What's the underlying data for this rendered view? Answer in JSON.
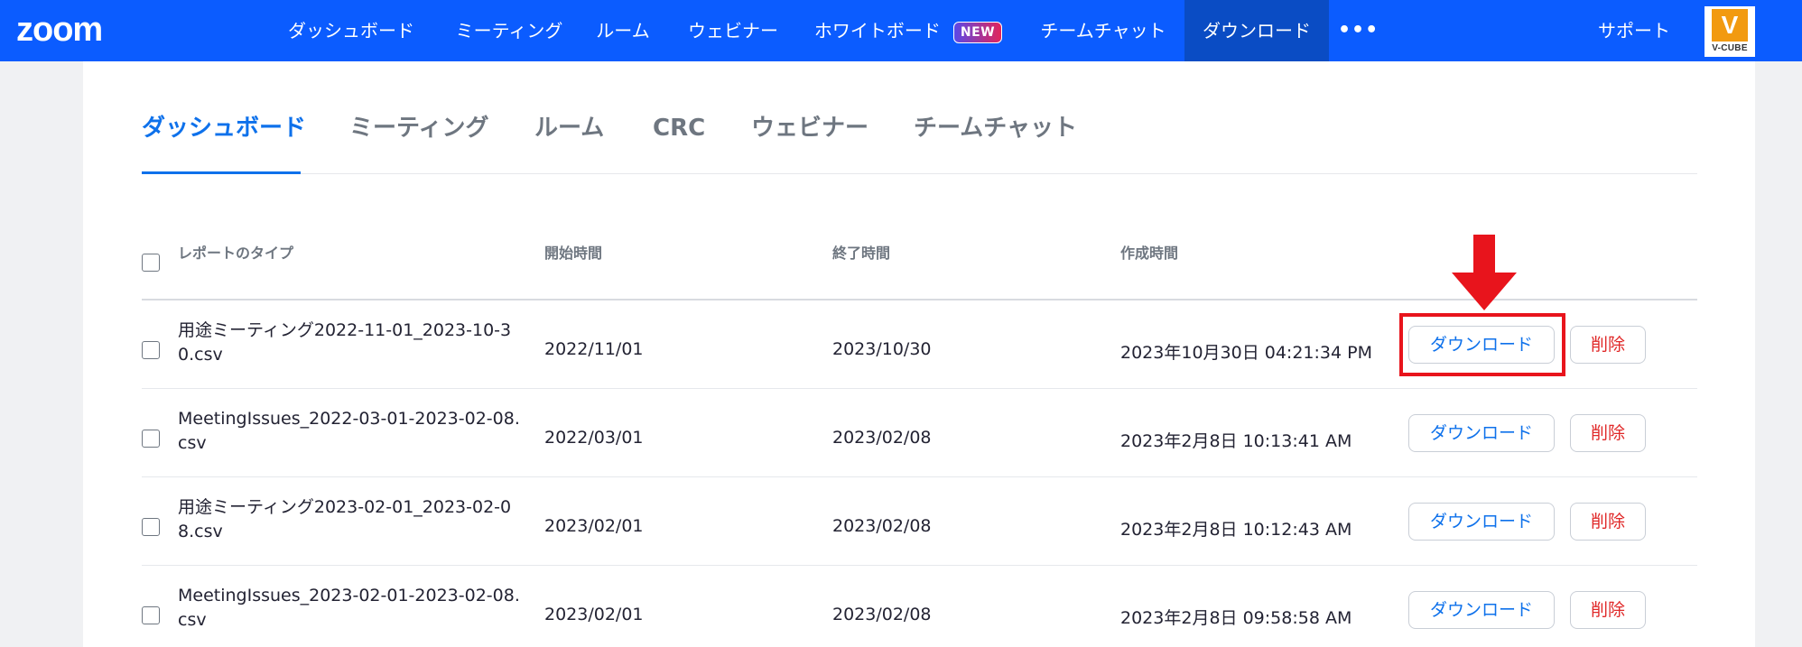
{
  "topnav": {
    "logo": "zoom",
    "items": [
      {
        "label": "ダッシュボード",
        "active": false
      },
      {
        "label": "ミーティング",
        "active": false
      },
      {
        "label": "ルーム",
        "active": false
      },
      {
        "label": "ウェビナー",
        "active": false
      },
      {
        "label": "ホワイトボード",
        "badge": "NEW",
        "active": false
      },
      {
        "label": "チームチャット",
        "active": false
      },
      {
        "label": "ダウンロード",
        "active": true
      }
    ],
    "more_icon": "more-horizontal-icon",
    "support_label": "サポート",
    "partner_logo": {
      "text": "V-CUBE",
      "name": "vcube-logo"
    },
    "colors": {
      "bar": "#0b5cff",
      "active": "#0a4cc4"
    }
  },
  "tabs": [
    {
      "label": "ダッシュボード",
      "active": true
    },
    {
      "label": "ミーティング",
      "active": false
    },
    {
      "label": "ルーム",
      "active": false
    },
    {
      "label": "CRC",
      "active": false
    },
    {
      "label": "ウェビナー",
      "active": false
    },
    {
      "label": "チームチャット",
      "active": false
    }
  ],
  "table": {
    "headers": {
      "type": "レポートのタイプ",
      "start": "開始時間",
      "end": "終了時間",
      "created": "作成時間"
    },
    "rows": [
      {
        "name": "用途ミーティング2022-11-01_2023-10-30.csv",
        "start": "2022/11/01",
        "end": "2023/10/30",
        "created": "2023年10月30日 04:21:34 PM",
        "download": "ダウンロード",
        "delete": "削除"
      },
      {
        "name": "MeetingIssues_2022-03-01-2023-02-08.csv",
        "start": "2022/03/01",
        "end": "2023/02/08",
        "created": "2023年2月8日 10:13:41 AM",
        "download": "ダウンロード",
        "delete": "削除"
      },
      {
        "name": "用途ミーティング2023-02-01_2023-02-08.csv",
        "start": "2023/02/01",
        "end": "2023/02/08",
        "created": "2023年2月8日 10:12:43 AM",
        "download": "ダウンロード",
        "delete": "削除"
      },
      {
        "name": "MeetingIssues_2023-02-01-2023-02-08.csv",
        "start": "2023/02/01",
        "end": "2023/02/08",
        "created": "2023年2月8日 09:58:58 AM",
        "download": "ダウンロード",
        "delete": "削除"
      }
    ]
  },
  "annotation": {
    "highlight_color": "#e8141c",
    "icon": "arrow-down-icon"
  },
  "colors": {
    "accent": "#0e71eb",
    "danger": "#e02828"
  }
}
